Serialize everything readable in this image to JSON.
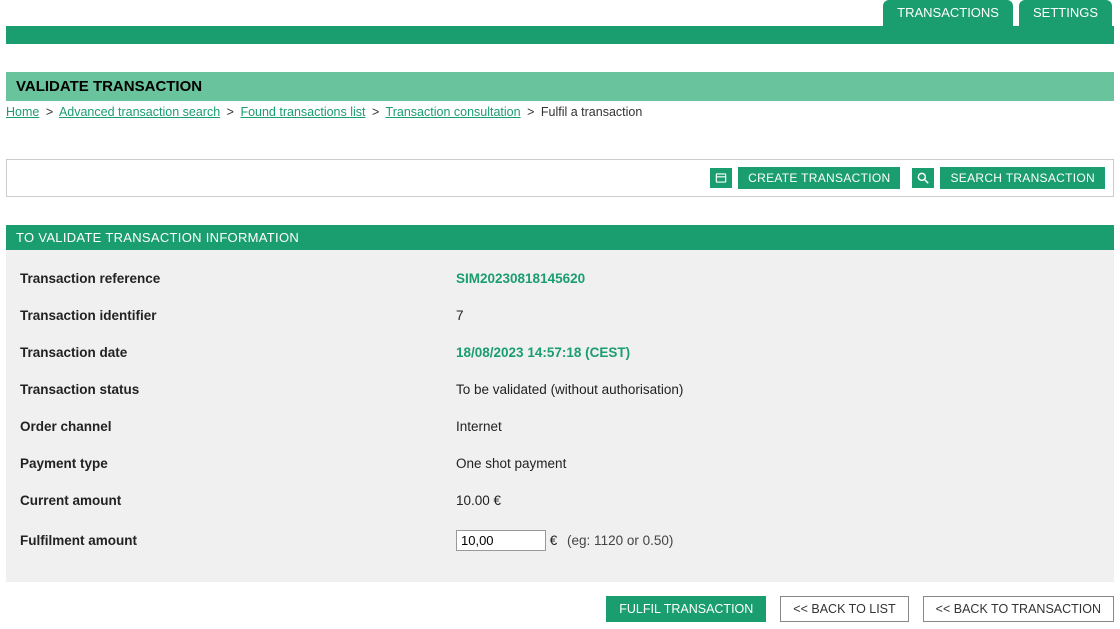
{
  "tabs": {
    "transactions": "TRANSACTIONS",
    "settings": "SETTINGS"
  },
  "pageTitle": "VALIDATE TRANSACTION",
  "breadcrumb": {
    "home": "Home",
    "advancedSearch": "Advanced transaction search",
    "foundList": "Found transactions list",
    "consultation": "Transaction consultation",
    "current": "Fulfil a transaction"
  },
  "toolbar": {
    "create": "CREATE TRANSACTION",
    "search": "SEARCH TRANSACTION"
  },
  "sectionHeader": "TO VALIDATE TRANSACTION INFORMATION",
  "fields": {
    "reference": {
      "label": "Transaction reference",
      "value": "SIM20230818145620"
    },
    "identifier": {
      "label": "Transaction identifier",
      "value": "7"
    },
    "date": {
      "label": "Transaction date",
      "value": "18/08/2023 14:57:18 (CEST)"
    },
    "status": {
      "label": "Transaction status",
      "value": "To be validated (without authorisation)"
    },
    "channel": {
      "label": "Order channel",
      "value": "Internet"
    },
    "paymentType": {
      "label": "Payment type",
      "value": "One shot payment"
    },
    "currentAmount": {
      "label": "Current amount",
      "value": "10.00 €"
    },
    "fulfilAmount": {
      "label": "Fulfilment amount",
      "value": "10,00",
      "currency": "€",
      "hint": "(eg: 1120 or 0.50)"
    }
  },
  "actions": {
    "fulfil": "FULFIL TRANSACTION",
    "backToList": "<< BACK TO LIST",
    "backToTransaction": "<< BACK TO TRANSACTION"
  }
}
